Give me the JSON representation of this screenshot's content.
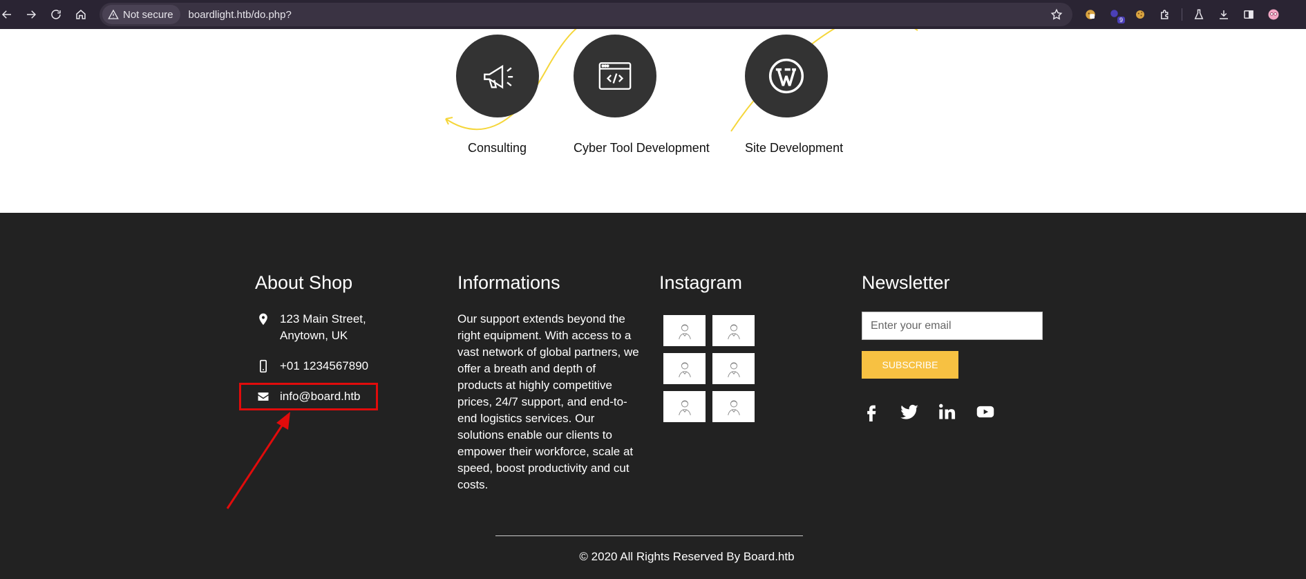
{
  "browser": {
    "security_label": "Not secure",
    "url": "boardlight.htb/do.php?",
    "extension_badge": "9"
  },
  "services": [
    {
      "label": "Consulting",
      "icon": "megaphone-icon"
    },
    {
      "label": "Cyber Tool Development",
      "icon": "code-window-icon"
    },
    {
      "label": "Site Development",
      "icon": "wordpress-icon"
    }
  ],
  "footer": {
    "about": {
      "title": "About Shop",
      "address_line1": "123 Main Street,",
      "address_line2": "Anytown, UK",
      "phone": "+01 1234567890",
      "email": "info@board.htb"
    },
    "informations": {
      "title": "Informations",
      "text": "Our support extends beyond the right equipment. With access to a vast network of global partners, we offer a breath and depth of products at highly competitive prices, 24/7 support, and end-to-end logistics services. Our solutions enable our clients to empower their workforce, scale at speed, boost productivity and cut costs."
    },
    "instagram": {
      "title": "Instagram",
      "thumb_count": 6
    },
    "newsletter": {
      "title": "Newsletter",
      "email_placeholder": "Enter your email",
      "subscribe_label": "SUBSCRIBE",
      "socials": [
        "facebook-icon",
        "twitter-icon",
        "linkedin-icon",
        "youtube-icon"
      ]
    },
    "copyright": "© 2020 All Rights Reserved By Board.htb"
  },
  "colors": {
    "footer_bg": "#222222",
    "accent": "#f7c142",
    "annotation": "#e10b0b",
    "circle_bg": "#333333"
  }
}
